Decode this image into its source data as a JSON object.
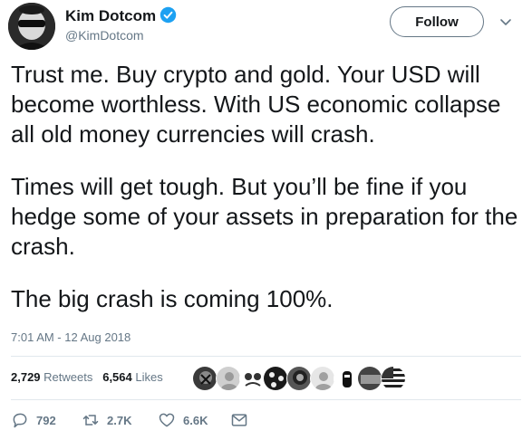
{
  "author": {
    "name": "Kim Dotcom",
    "handle": "@KimDotcom"
  },
  "follow_label": "Follow",
  "tweet": {
    "paragraphs": [
      "Trust me. Buy crypto and gold. Your USD will become worthless. With US economic collapse all old money currencies will crash.",
      "Times will get tough. But you’ll be fine if you hedge some of your assets in preparation for the crash.",
      "The big crash is coming 100%."
    ],
    "timestamp": "7:01 AM - 12 Aug 2018"
  },
  "stats": {
    "retweets_count": "2,729",
    "retweets_label": "Retweets",
    "likes_count": "6,564",
    "likes_label": "Likes"
  },
  "actions": {
    "reply_count": "792",
    "retweet_count": "2.7K",
    "like_count": "6.6K"
  },
  "colors": {
    "text": "#14171a",
    "secondary": "#657786",
    "verified": "#1da1f2",
    "divider": "#e1e8ed"
  },
  "icons": [
    "verified-icon",
    "chevron-down-icon",
    "reply-icon",
    "retweet-icon",
    "like-icon",
    "direct-message-icon"
  ]
}
